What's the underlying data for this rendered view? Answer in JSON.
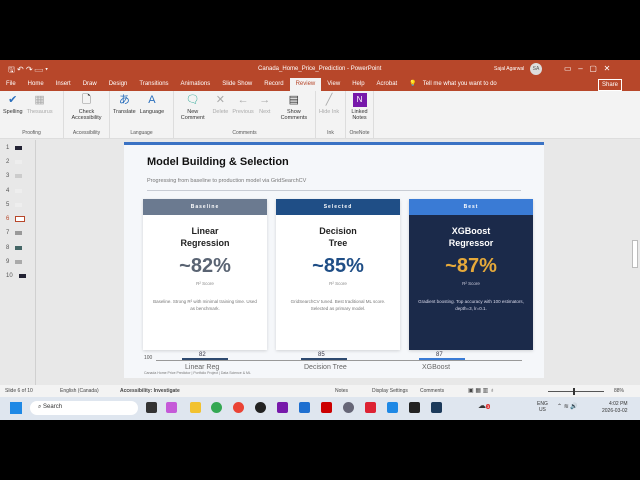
{
  "window": {
    "title": "Canada_Home_Price_Prediction  -  PowerPoint",
    "user": "Sajal Agarwal",
    "avatar": "SA",
    "share": "Share"
  },
  "tabs": [
    "File",
    "Home",
    "Insert",
    "Draw",
    "Design",
    "Transitions",
    "Animations",
    "Slide Show",
    "Record",
    "Review",
    "View",
    "Help",
    "Acrobat"
  ],
  "active_tab": "Review",
  "tell_me": "Tell me what you want to do",
  "ribbon": {
    "proofing": {
      "label": "Proofing",
      "spelling": "Spelling",
      "thesaurus": "Thesaurus"
    },
    "accessibility": {
      "label": "Accessibility",
      "check": "Check Accessibility"
    },
    "language": {
      "label": "Language",
      "translate": "Translate",
      "language": "Language"
    },
    "comments": {
      "label": "Comments",
      "new": "New Comment",
      "delete": "Delete",
      "previous": "Previous",
      "next": "Next",
      "show": "Show Comments"
    },
    "ink": {
      "label": "Ink",
      "hide": "Hide Ink"
    },
    "onenote": {
      "label": "OneNote",
      "linked": "Linked Notes"
    }
  },
  "thumbnails": [
    "1",
    "2",
    "3",
    "4",
    "5",
    "6",
    "7",
    "8",
    "9",
    "10"
  ],
  "current_slide": 6,
  "slide": {
    "title": "Model Building & Selection",
    "subtitle": "Progressing from baseline to production model via GridSearchCV",
    "accent": "#3a72c4",
    "cards": [
      {
        "badge": "Baseline",
        "name1": "Linear",
        "name2": "Regression",
        "score": "~82%",
        "score_label": "R² Score",
        "desc": "Baseline. Strong R² with minimal training time. Used as benchmark.",
        "header_color": "#6b7a90",
        "score_color": "#5a6473"
      },
      {
        "badge": "Selected",
        "name1": "Decision",
        "name2": "Tree",
        "score": "~85%",
        "score_label": "R² Score",
        "desc": "GridSearchCV tuned. Best traditional ML score. Selected as primary model.",
        "header_color": "#1f4e86",
        "score_color": "#1f4e86"
      },
      {
        "badge": "Best",
        "name1": "XGBoost",
        "name2": "Regressor",
        "score": "~87%",
        "score_label": "R² Score",
        "desc": "Gradient boosting. Top accuracy with 100 estimators, depth=3, lr=0.1.",
        "header_color": "#3a7bd5",
        "score_color": "#e6a93a"
      }
    ],
    "chart": {
      "axis_top": "100",
      "bars": [
        {
          "label": "Linear Reg",
          "value": "82"
        },
        {
          "label": "Decision Tree",
          "value": "85"
        },
        {
          "label": "XGBoost",
          "value": "87"
        }
      ]
    },
    "footer": "Canada Home Price Predictor  |  Portfolio Project  |  Data Science & ML"
  },
  "status": {
    "slide": "Slide 6 of 10",
    "language": "English (Canada)",
    "accessibility": "Accessibility: Investigate",
    "notes": "Notes",
    "display": "Display Settings",
    "comments": "Comments",
    "zoom": "88%"
  },
  "taskbar": {
    "search": "Search",
    "lang1": "ENG",
    "lang2": "US",
    "time": "4:02 PM",
    "date": "2026-03-02",
    "weather_badge": "3"
  }
}
